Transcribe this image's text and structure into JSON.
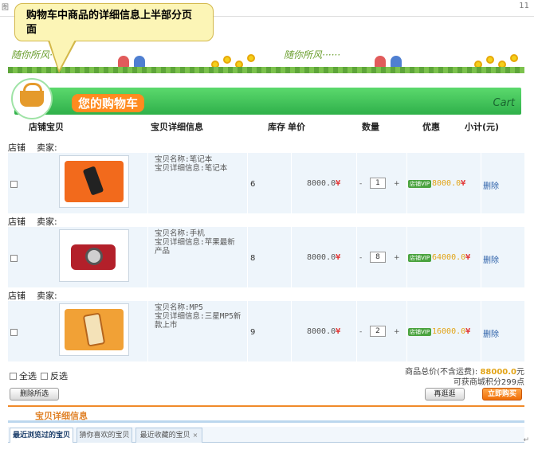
{
  "document": {
    "top_label": "图",
    "page_number": "11"
  },
  "callout": {
    "line1": "购物车中商品的详细信息上半部分页",
    "line2": "面"
  },
  "banner": {
    "slogan": "随你所风······"
  },
  "cart": {
    "title": "您的购物车",
    "title_en": "Cart"
  },
  "columns": {
    "shop_item": "店铺宝贝",
    "item_detail": "宝贝详细信息",
    "stock": "库存",
    "unit_price": "单价",
    "quantity": "数量",
    "discount": "优惠",
    "subtotal": "小计(元)"
  },
  "store_label": "店铺",
  "seller_label": "卖家:",
  "items": [
    {
      "name_line": "宝贝名称:笔记本",
      "detail_line1": "宝贝详细信息:笔记本",
      "detail_line2": "",
      "stock": "6",
      "price": "8000.0",
      "quantity": "1",
      "vip": "店铺VIP",
      "subtotal": "8000.0",
      "delete": "删除",
      "image": "phone-image"
    },
    {
      "name_line": "宝贝名称:手机",
      "detail_line1": "宝贝详细信息:苹果最新",
      "detail_line2": "产品",
      "stock": "8",
      "price": "8000.0",
      "quantity": "8",
      "vip": "店铺VIP",
      "subtotal": "64000.0",
      "delete": "删除",
      "image": "camera-image"
    },
    {
      "name_line": "宝贝名称:MP5",
      "detail_line1": "宝贝详细信息:三星MP5新",
      "detail_line2": "款上市",
      "stock": "9",
      "price": "8000.0",
      "quantity": "2",
      "vip": "店铺VIP",
      "subtotal": "16000.0",
      "delete": "删除",
      "image": "slide-phone-image"
    }
  ],
  "currency_symbol": "¥",
  "footer": {
    "select_all": "全选",
    "invert_select": "反选",
    "total_prefix": "商品总价(不含运费):",
    "total_value": "88000.0",
    "total_suffix": "元",
    "points": "可获商城积分299点",
    "delete_selected": "删除所选",
    "continue_shopping": "再逛逛",
    "buy_now": "立即购买"
  },
  "detail_section": {
    "title": "宝贝详细信息",
    "tabs": [
      "最近浏览过的宝贝",
      "猜你喜欢的宝贝",
      "最近收藏的宝贝"
    ],
    "tab_close": "×"
  },
  "colors": {
    "accent_green": "#2fb04a",
    "accent_orange": "#ef6e08",
    "row_bg": "#eef5fb",
    "link_blue": "#2b5fa8"
  }
}
